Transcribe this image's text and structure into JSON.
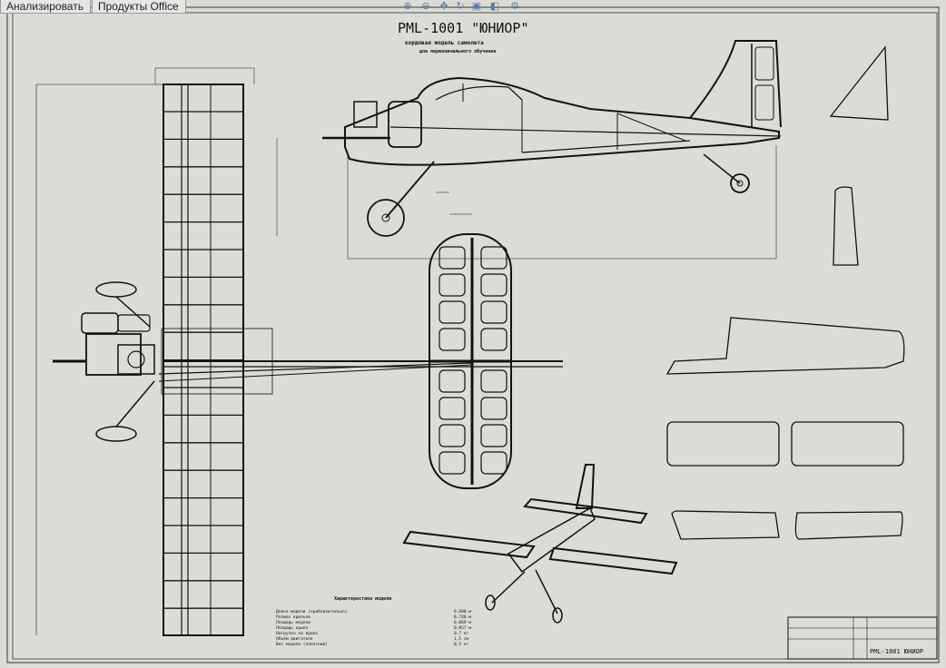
{
  "toolbar": {
    "analyze_label": "Анализировать",
    "products_label": "Продукты Office",
    "view_icons": [
      "zoom-in-icon",
      "zoom-out-icon",
      "pan-icon",
      "rotate-icon",
      "view-icon",
      "display-style-icon",
      "settings-icon"
    ]
  },
  "drawing": {
    "title": "РМL-1001 \"ЮНИОР\"",
    "subtitle": "кордовая модель самолета",
    "subtitle2": "для первоначального обучения",
    "stamp_name": "РМL-1001 ЮНИОР",
    "specs_title": "Характеристики модели",
    "specs": [
      {
        "label": "Длина модели (приблизительно)",
        "value": "0,600 м"
      },
      {
        "label": "Размах крыльев",
        "value": "0,740 м"
      },
      {
        "label": "Площадь модели",
        "value": "0,069 м"
      },
      {
        "label": "Площадь крыла",
        "value": "0,057 м"
      },
      {
        "label": "Нагрузка на крыло",
        "value": "0,7 кг"
      },
      {
        "label": "Объём двигателя",
        "value": "1,5 см"
      },
      {
        "label": "Вес модели (полетный)",
        "value": "0,5 кг"
      }
    ]
  },
  "colors": {
    "paper": "#dcdcd6",
    "ink": "#111111",
    "toolbar": "#e6e6e6"
  }
}
